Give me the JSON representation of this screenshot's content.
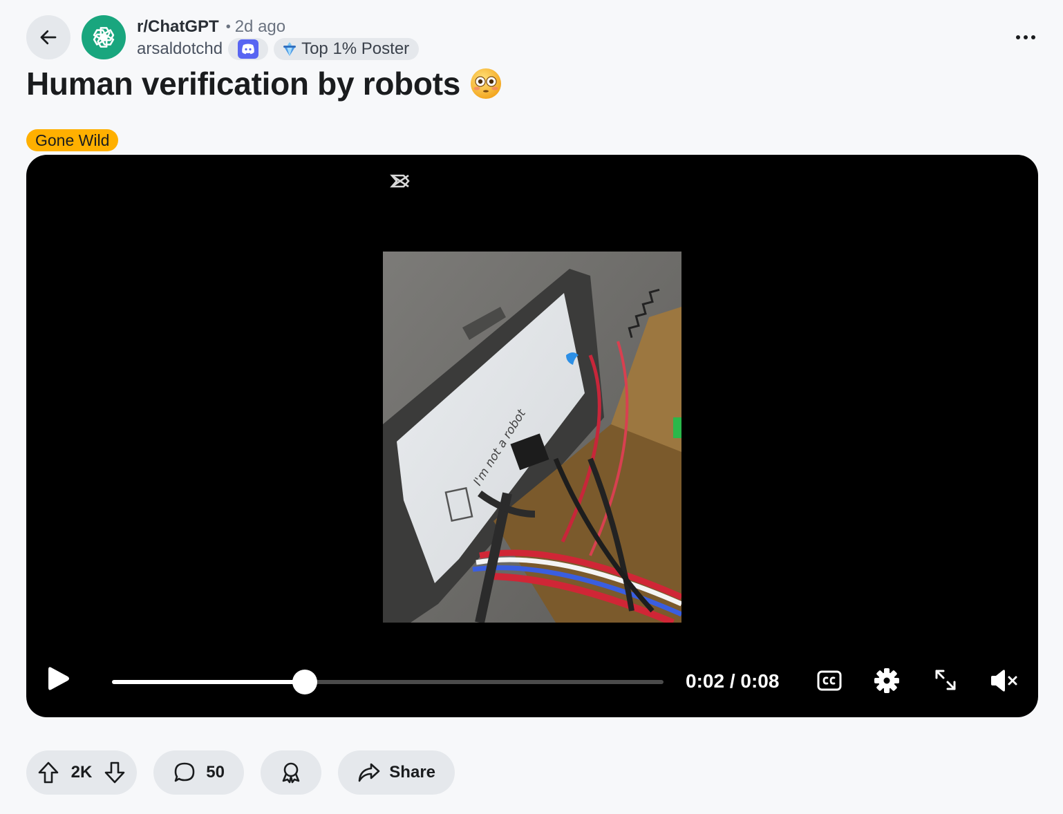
{
  "header": {
    "subreddit": "r/ChatGPT",
    "separator": "•",
    "time_ago": "2d ago",
    "username": "arsaldotchd",
    "flair_badge": "Top 1% Poster"
  },
  "post": {
    "title": "Human verification by robots",
    "title_emoji": "flushed-face",
    "flair": "Gone Wild",
    "flair_color": "#ffb000"
  },
  "video": {
    "current_time": "0:02",
    "duration": "0:08",
    "time_display": "0:02 / 0:08",
    "progress_fraction": 0.35,
    "muted": true,
    "frame_text": "I'm not a robot"
  },
  "actions": {
    "vote_count": "2K",
    "comment_count": "50",
    "share_label": "Share"
  },
  "colors": {
    "subreddit_avatar": "#19a67e",
    "discord": "#5865f2",
    "page_bg": "#f7f8fa",
    "pill_bg": "#e5e8ec"
  },
  "icons": [
    "back-arrow-icon",
    "chatgpt-logo-icon",
    "discord-icon",
    "top-poster-icon",
    "more-options-icon",
    "play-icon",
    "captions-icon",
    "settings-gear-icon",
    "fullscreen-icon",
    "muted-speaker-icon",
    "upvote-icon",
    "downvote-icon",
    "comment-icon",
    "award-icon",
    "share-icon"
  ]
}
